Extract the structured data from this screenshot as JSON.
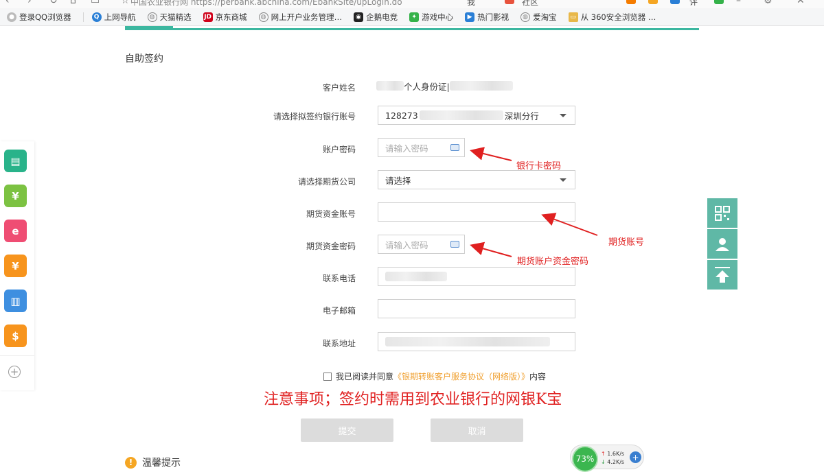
{
  "browser": {
    "url_text": "中国农业银行网  https://perbank.abchina.com/EbankSite/upLogin.do",
    "ext_labels": [
      "我",
      "社区",
      "评"
    ],
    "bookmarks": [
      {
        "label": "登录QQ浏览器",
        "icon": "user-icon",
        "color": "#bbbbbb"
      },
      {
        "label": "上网导航",
        "icon": "q-logo-icon",
        "color": "#2a7fd6"
      },
      {
        "label": "天猫精选",
        "icon": "globe-icon",
        "color": "#888888"
      },
      {
        "label": "京东商城",
        "icon": "jd-logo-icon",
        "color": "#d0021b"
      },
      {
        "label": "网上开户业务管理…",
        "icon": "globe-icon",
        "color": "#888888"
      },
      {
        "label": "企鹅电竞",
        "icon": "penguin-icon",
        "color": "#222222"
      },
      {
        "label": "游戏中心",
        "icon": "gamepad-icon",
        "color": "#35b24a"
      },
      {
        "label": "热门影视",
        "icon": "play-icon",
        "color": "#2a7fd6"
      },
      {
        "label": "爱淘宝",
        "icon": "globe-icon",
        "color": "#888888"
      },
      {
        "label": "从 360安全浏览器 …",
        "icon": "folder-icon",
        "color": "#e8b84a"
      }
    ]
  },
  "page": {
    "section_title": "自助签约",
    "form": {
      "name_label": "客户姓名",
      "name_value_suffix": "个人身份证|",
      "bank_account_label": "请选择拟签约银行账号",
      "bank_account_prefix": "128273",
      "bank_account_suffix": "深圳分行",
      "account_password_label": "账户密码",
      "account_password_placeholder": "请输入密码",
      "futures_company_label": "请选择期货公司",
      "futures_company_value": "请选择",
      "futures_account_label": "期货资金账号",
      "futures_account_value": "",
      "futures_password_label": "期货资金密码",
      "futures_password_placeholder": "请输入密码",
      "phone_label": "联系电话",
      "email_label": "电子邮箱",
      "email_value": "",
      "address_label": "联系地址"
    },
    "annotations": {
      "bank_card_password": "银行卡密码",
      "futures_account": "期货账号",
      "futures_password": "期货账户资金密码"
    },
    "agreement": {
      "prefix": "我已阅读并同意",
      "link": "《银期转账客户服务协议（网络版）》",
      "suffix": "内容"
    },
    "notice": "注意事项；签约时需用到农业银行的网银K宝",
    "buttons": {
      "submit": "提交",
      "cancel": "取消"
    },
    "tip_title": "温馨提示"
  },
  "left_sidebar": [
    {
      "icon": "card-icon",
      "color": "#29b38a",
      "glyph": "▤"
    },
    {
      "icon": "yuan-exchange-icon",
      "color": "#7cc242",
      "glyph": "¥"
    },
    {
      "icon": "e-chart-icon",
      "color": "#ef4d73",
      "glyph": "e"
    },
    {
      "icon": "coin-stack-icon",
      "color": "#f7941d",
      "glyph": "¥"
    },
    {
      "icon": "bank-card-icon",
      "color": "#3e8fe0",
      "glyph": "▥"
    },
    {
      "icon": "dollar-coin-icon",
      "color": "#f7941d",
      "glyph": "$"
    }
  ],
  "speed_widget": {
    "percent": "73%",
    "up": "1.6K/s",
    "down": "4.2K/s"
  }
}
